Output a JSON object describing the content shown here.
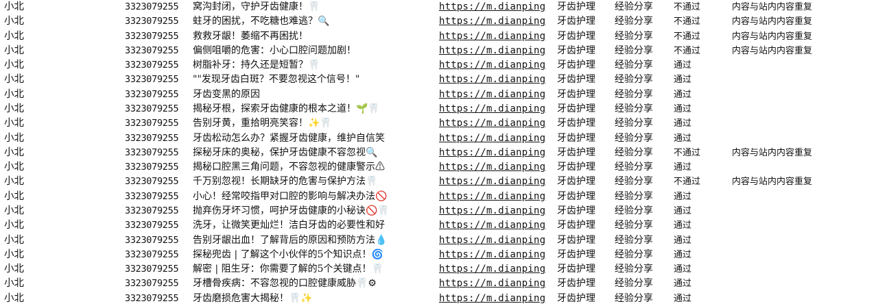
{
  "rows": [
    {
      "user": "小北",
      "id": "3323079255",
      "title": "窝沟封闭，守护牙齿健康！🦷",
      "url": "https://m.dianping",
      "category": "牙齿护理",
      "type": "经验分享",
      "status": "不通过",
      "reason": "内容与站内内容重复"
    },
    {
      "user": "小北",
      "id": "3323079255",
      "title": "蛀牙的困扰，不吃糖也难逃？🔍",
      "url": "https://m.dianping",
      "category": "牙齿护理",
      "type": "经验分享",
      "status": "不通过",
      "reason": "内容与站内内容重复"
    },
    {
      "user": "小北",
      "id": "3323079255",
      "title": "救救牙龈！萎缩不再困扰！",
      "url": "https://m.dianping",
      "category": "牙齿护理",
      "type": "经验分享",
      "status": "不通过",
      "reason": "内容与站内内容重复"
    },
    {
      "user": "小北",
      "id": "3323079255",
      "title": "偏侧咀嚼的危害：小心口腔问题加剧！",
      "url": "https://m.dianping",
      "category": "牙齿护理",
      "type": "经验分享",
      "status": "不通过",
      "reason": "内容与站内内容重复"
    },
    {
      "user": "小北",
      "id": "3323079255",
      "title": "树脂补牙：持久还是短暂？🦷",
      "url": "https://m.dianping",
      "category": "牙齿护理",
      "type": "经验分享",
      "status": "通过",
      "reason": ""
    },
    {
      "user": "小北",
      "id": "3323079255",
      "title": "\"\"发现牙齿白斑？不要忽视这个信号！\"",
      "url": "https://m.dianping",
      "category": "牙齿护理",
      "type": "经验分享",
      "status": "通过",
      "reason": ""
    },
    {
      "user": "小北",
      "id": "3323079255",
      "title": "牙齿变黑的原因",
      "url": "https://m.dianping",
      "category": "牙齿护理",
      "type": "经验分享",
      "status": "通过",
      "reason": ""
    },
    {
      "user": "小北",
      "id": "3323079255",
      "title": "揭秘牙根，探索牙齿健康的根本之道！🌱🦷",
      "url": "https://m.dianping",
      "category": "牙齿护理",
      "type": "经验分享",
      "status": "通过",
      "reason": ""
    },
    {
      "user": "小北",
      "id": "3323079255",
      "title": "告别牙黄，重拾明亮笑容！✨🦷",
      "url": "https://m.dianping",
      "category": "牙齿护理",
      "type": "经验分享",
      "status": "通过",
      "reason": ""
    },
    {
      "user": "小北",
      "id": "3323079255",
      "title": "牙齿松动怎么办？紧握牙齿健康，维护自信笑",
      "url": "https://m.dianping",
      "category": "牙齿护理",
      "type": "经验分享",
      "status": "通过",
      "reason": ""
    },
    {
      "user": "小北",
      "id": "3323079255",
      "title": "探秘牙床的奥秘，保护牙齿健康不容忽视🔍",
      "url": "https://m.dianping",
      "category": "牙齿护理",
      "type": "经验分享",
      "status": "不通过",
      "reason": "内容与站内内容重复"
    },
    {
      "user": "小北",
      "id": "3323079255",
      "title": "揭秘口腔黑三角问题，不容忽视的健康警示⚠",
      "url": "https://m.dianping",
      "category": "牙齿护理",
      "type": "经验分享",
      "status": "通过",
      "reason": ""
    },
    {
      "user": "小北",
      "id": "3323079255",
      "title": "千万别忽视！长期缺牙的危害与保护方法🦷",
      "url": "https://m.dianping",
      "category": "牙齿护理",
      "type": "经验分享",
      "status": "不通过",
      "reason": "内容与站内内容重复"
    },
    {
      "user": "小北",
      "id": "3323079255",
      "title": "小心！经常咬指甲对口腔的影响与解决办法🚫",
      "url": "https://m.dianping",
      "category": "牙齿护理",
      "type": "经验分享",
      "status": "通过",
      "reason": ""
    },
    {
      "user": "小北",
      "id": "3323079255",
      "title": "抛弃伤牙坏习惯，呵护牙齿健康的小秘诀🚫🦷",
      "url": "https://m.dianping",
      "category": "牙齿护理",
      "type": "经验分享",
      "status": "通过",
      "reason": ""
    },
    {
      "user": "小北",
      "id": "3323079255",
      "title": "洗牙，让微笑更灿烂！洁白牙齿的必要性和好",
      "url": "https://m.dianping",
      "category": "牙齿护理",
      "type": "经验分享",
      "status": "通过",
      "reason": ""
    },
    {
      "user": "小北",
      "id": "3323079255",
      "title": "告别牙龈出血！了解背后的原因和预防方法💧",
      "url": "https://m.dianping",
      "category": "牙齿护理",
      "type": "经验分享",
      "status": "通过",
      "reason": ""
    },
    {
      "user": "小北",
      "id": "3323079255",
      "title": "探秘兜齿 | 了解这个小伙伴的5个知识点！🌀",
      "url": "https://m.dianping",
      "category": "牙齿护理",
      "type": "经验分享",
      "status": "通过",
      "reason": ""
    },
    {
      "user": "小北",
      "id": "3323079255",
      "title": "解密 | 阻生牙：你需要了解的5个关键点！🦷",
      "url": "https://m.dianping",
      "category": "牙齿护理",
      "type": "经验分享",
      "status": "通过",
      "reason": ""
    },
    {
      "user": "小北",
      "id": "3323079255",
      "title": "牙槽骨疾病：不容忽视的口腔健康威胁🦷⚙",
      "url": "https://m.dianping",
      "category": "牙齿护理",
      "type": "经验分享",
      "status": "通过",
      "reason": ""
    },
    {
      "user": "小北",
      "id": "3323079255",
      "title": "牙齿磨损危害大揭秘！🦷✨",
      "url": "https://m.dianping",
      "category": "牙齿护理",
      "type": "经验分享",
      "status": "通过",
      "reason": ""
    }
  ]
}
